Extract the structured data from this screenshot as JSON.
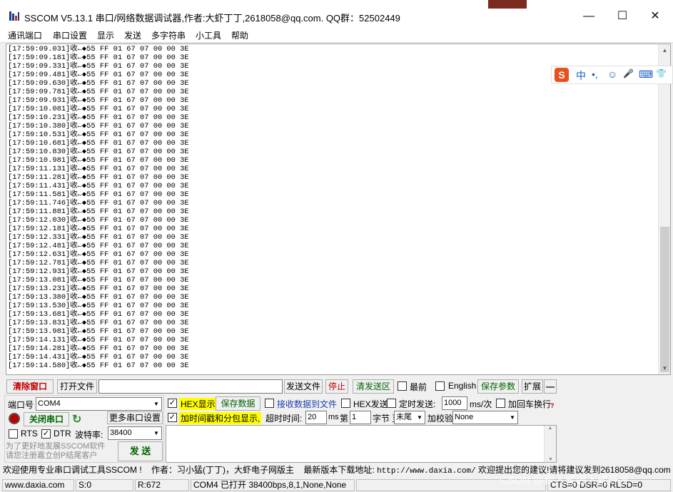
{
  "window": {
    "title": "SSCOM V5.13.1 串口/网络数据调试器,作者:大虾丁丁,2618058@qq.com. QQ群：52502449",
    "minimize": "—",
    "maximize": "☐",
    "close": "✕"
  },
  "menu": [
    "通讯端口",
    "串口设置",
    "显示",
    "发送",
    "多字符串",
    "小工具",
    "帮助"
  ],
  "receive_log": {
    "payload": "55 FF 01 67 07 00 00 3E",
    "direction": "收←◆",
    "timestamps": [
      "17:59:09.031",
      "17:59:09.181",
      "17:59:09.331",
      "17:59:09.481",
      "17:59:09.630",
      "17:59:09.781",
      "17:59:09.931",
      "17:59:10.081",
      "17:59:10.231",
      "17:59:10.380",
      "17:59:10.531",
      "17:59:10.681",
      "17:59:10.830",
      "17:59:10.981",
      "17:59:11.131",
      "17:59:11.281",
      "17:59:11.431",
      "17:59:11.581",
      "17:59:11.746",
      "17:59:11.881",
      "17:59:12.030",
      "17:59:12.181",
      "17:59:12.331",
      "17:59:12.481",
      "17:59:12.631",
      "17:59:12.781",
      "17:59:12.931",
      "17:59:13.081",
      "17:59:13.231",
      "17:59:13.380",
      "17:59:13.530",
      "17:59:13.681",
      "17:59:13.831",
      "17:59:13.981",
      "17:59:14.131",
      "17:59:14.281",
      "17:59:14.431",
      "17:59:14.580"
    ]
  },
  "ime_toolbar": {
    "logo": "S",
    "items": [
      "中",
      "•,",
      "☺",
      "🎤",
      "⌨",
      "👕"
    ]
  },
  "toolbar": {
    "clear_window": "清除窗口",
    "open_file": "打开文件",
    "file_path": "",
    "send_file": "发送文件",
    "stop": "停止",
    "clear_send": "清发送区",
    "topmost": "最前",
    "english": "English",
    "save_params": "保存参数",
    "expand": "扩展",
    "collapse": "—"
  },
  "port": {
    "port_label": "端口号",
    "port_value": "COM4",
    "close_port": "关闭串口",
    "more_settings": "更多串口设置",
    "rts": "RTS",
    "dtr": "DTR",
    "baud_label": "波特率:",
    "baud_value": "38400",
    "promo": "为了更好地发展SSCOM软件\n请您注册嘉立创P结尾客户",
    "send": "发 送"
  },
  "options": {
    "hex_display": "HEX显示",
    "save_data": "保存数据",
    "recv_to_file": "接收数据到文件",
    "hex_send": "HEX发送",
    "timed_send": "定时发送:",
    "interval": "1000",
    "interval_unit": "ms/次",
    "add_crlf": "加回车换行",
    "timestamp": "加时间戳和分包显示,",
    "timeout_label": "超时时间:",
    "timeout_value": "20",
    "timeout_unit": "ms",
    "byte_prefix": "第",
    "byte_index": "1",
    "byte_to": "字节 至",
    "byte_end": "末尾",
    "checksum_label": "加校验",
    "checksum_value": "None",
    "send_text": ""
  },
  "ticker": {
    "welcome": "欢迎使用专业串口调试工具SSCOM !",
    "author": "作者：习小猛(丁丁)，大虾电子网版主",
    "download_label": "最新版本下载地址:",
    "download_url": "http://www.daxia.com/",
    "feedback": "欢迎提出您的建议!请将建议发到2618058@qq.com"
  },
  "statusbar": {
    "site": "www.daxia.com",
    "sent": "S:0",
    "received": "R:672",
    "port_status": "COM4 已打开  38400bps,8,1,None,None",
    "lines": "CTS=0 DSR=0 RLSD=0"
  },
  "watermark": "CSDN @嵌入式嵌入式开发",
  "colors": {
    "accent_green": "#006400",
    "highlight_yellow": "#ffff00",
    "stop_red": "#c00000"
  }
}
